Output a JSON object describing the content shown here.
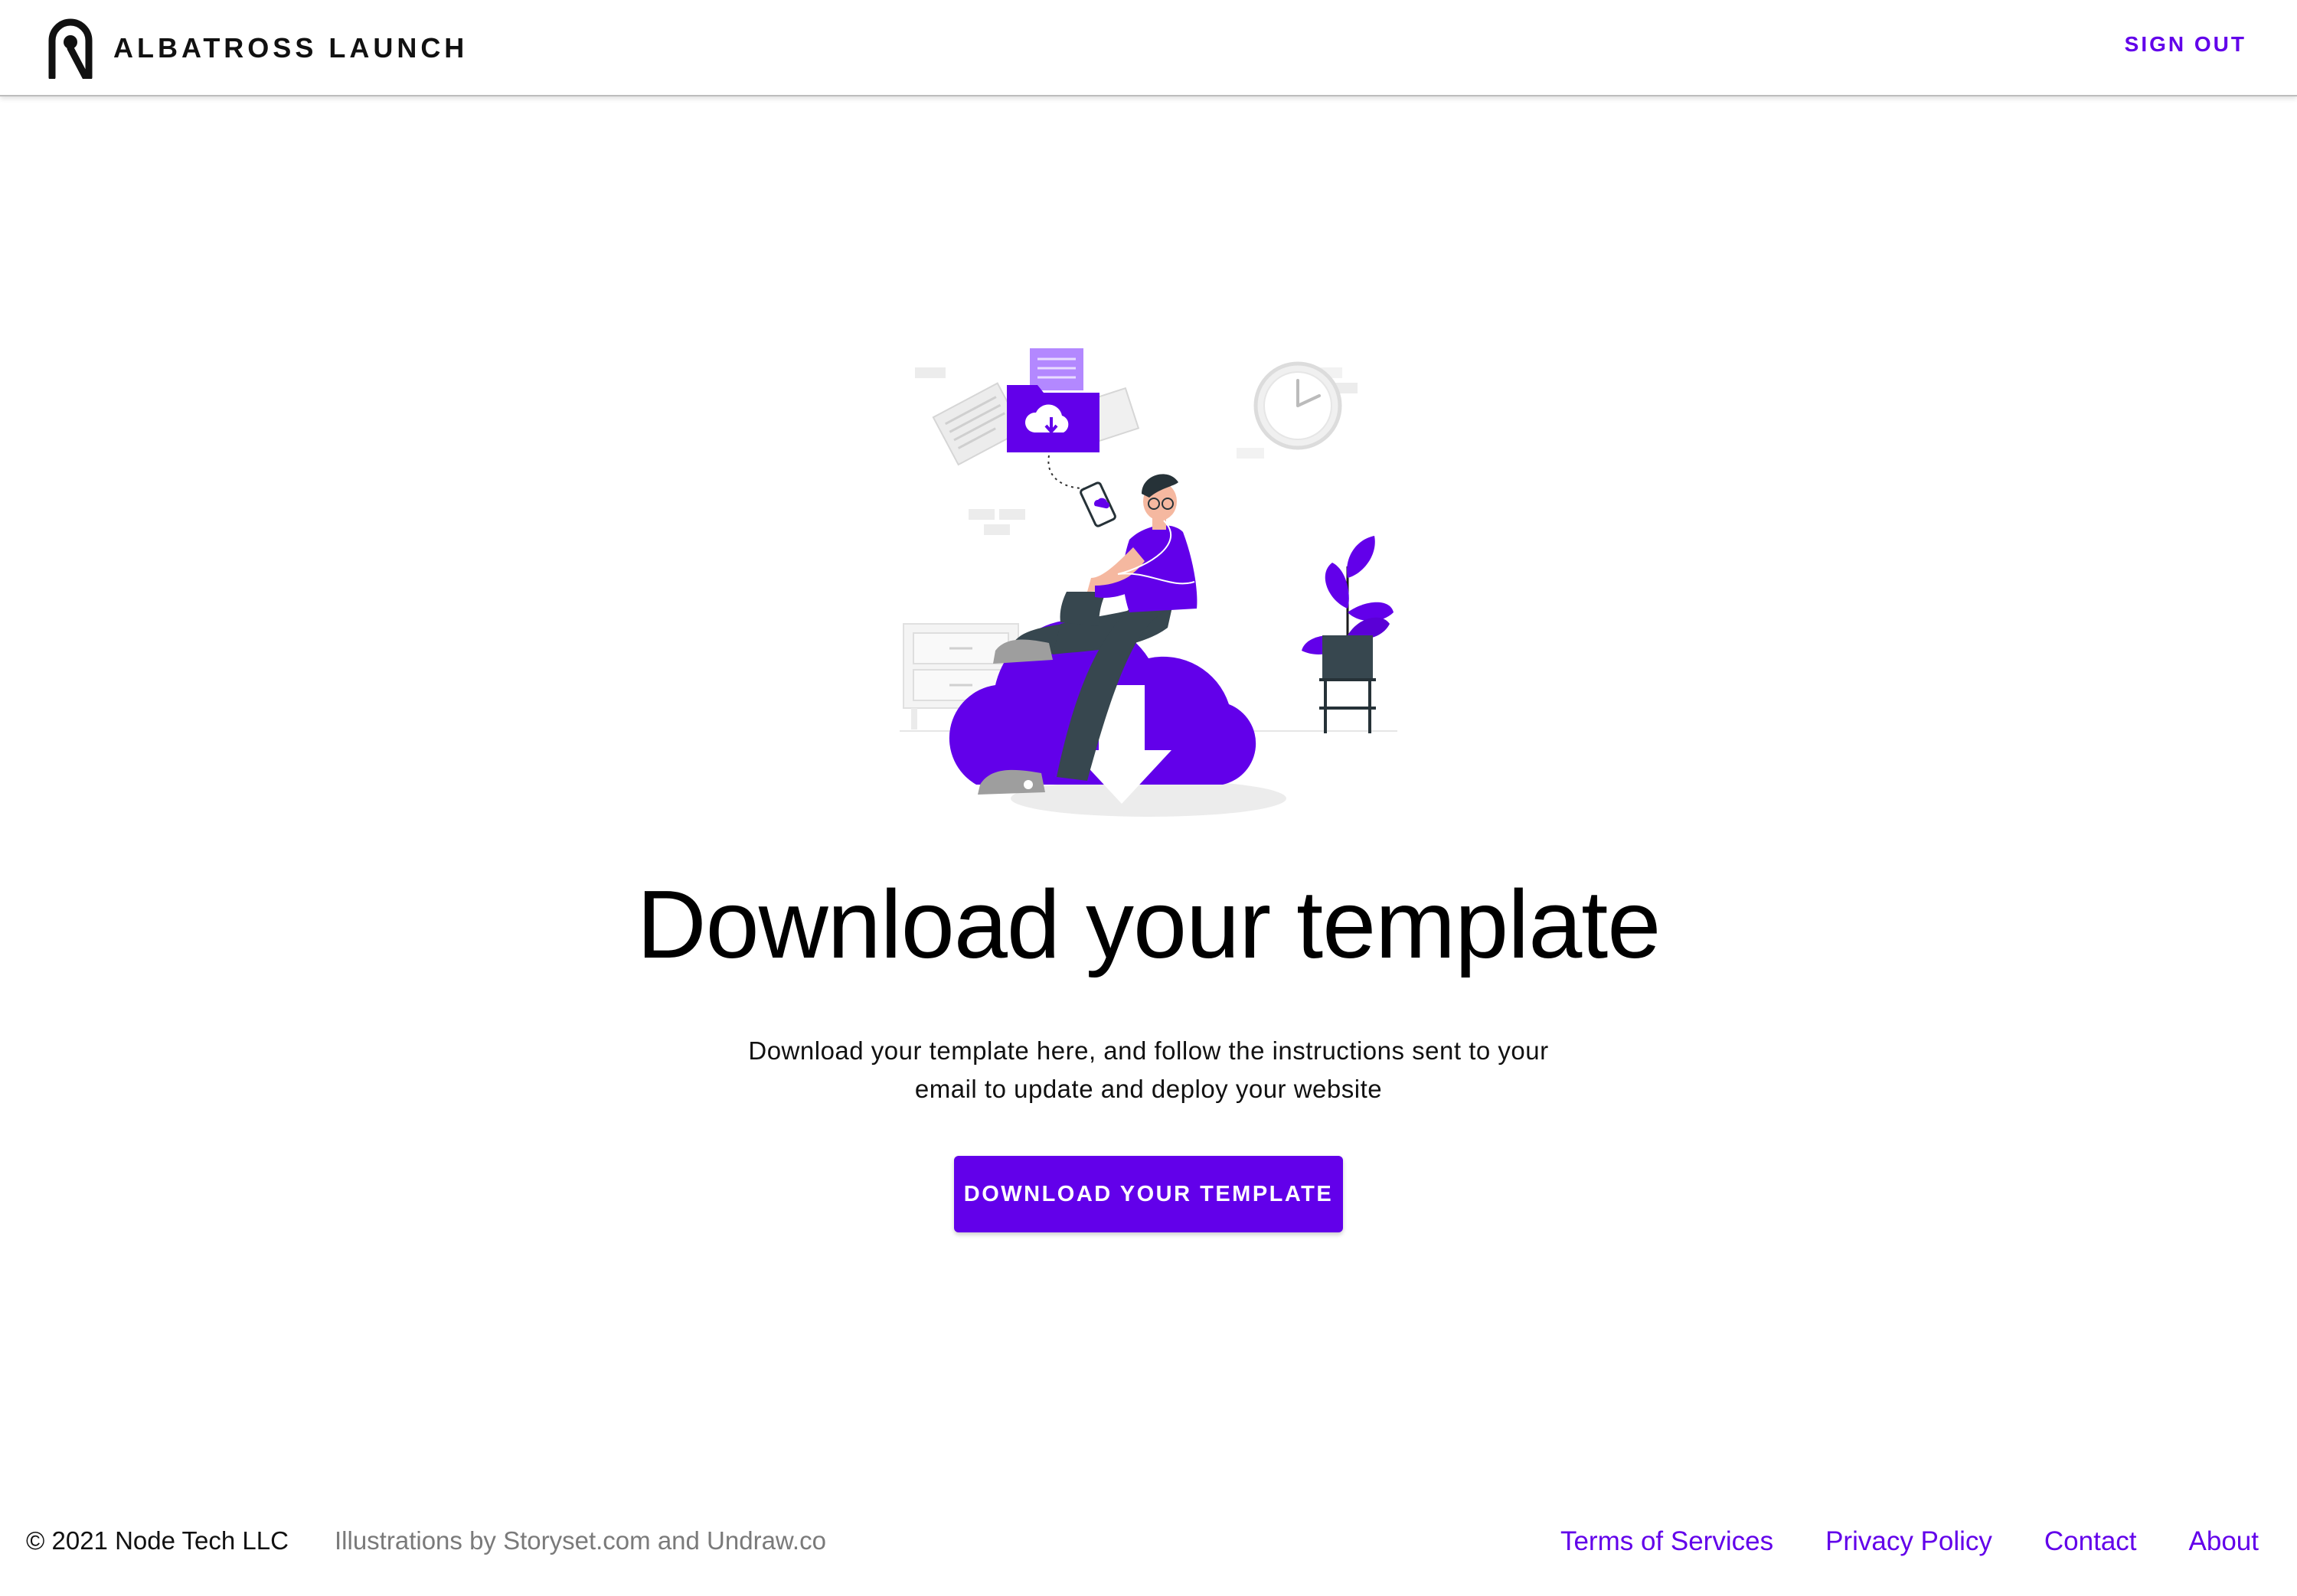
{
  "header": {
    "brand_name": "ALBATROSS LAUNCH",
    "sign_out_label": "SIGN OUT"
  },
  "hero": {
    "title": "Download your template",
    "description": "Download your template here, and follow the instructions sent to your email to update and deploy your website",
    "cta_label": "DOWNLOAD YOUR TEMPLATE",
    "illustration_icon": "cloud-download-illustration"
  },
  "footer": {
    "copyright": "© 2021 Node Tech LLC",
    "credits": "Illustrations by Storyset.com and Undraw.co",
    "links": [
      {
        "label": "Terms of Services"
      },
      {
        "label": "Privacy Policy"
      },
      {
        "label": "Contact"
      },
      {
        "label": "About"
      }
    ]
  },
  "colors": {
    "accent": "#6200ea",
    "text": "#111111",
    "muted": "#7a7a7a"
  }
}
